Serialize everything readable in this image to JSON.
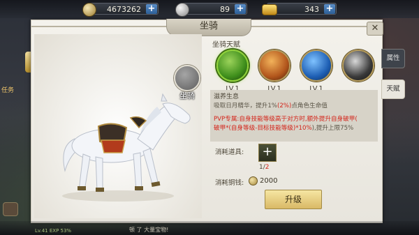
{
  "currencies": [
    {
      "icon": "copper-coin-icon",
      "value": "4673262"
    },
    {
      "icon": "silver-coin-icon",
      "value": "89"
    },
    {
      "icon": "gold-ingot-icon",
      "value": "343"
    }
  ],
  "panel": {
    "title": "坐骑",
    "close_icon": "close-icon",
    "mount_badge_label": "坐骑"
  },
  "talent_section": {
    "title": "坐骑天赋",
    "talents": [
      {
        "icon": "green-horse-talent-icon",
        "level": "LV.1",
        "color": "#3f8f1c",
        "selected": true
      },
      {
        "icon": "crossed-swords-talent-icon",
        "level": "LV.1",
        "color": "#b2561c",
        "selected": false
      },
      {
        "icon": "shield-talent-icon",
        "level": "LV.1",
        "color": "#1e5fb4",
        "selected": false
      },
      {
        "icon": "dragon-talent-icon",
        "level": "",
        "color": "#3a3a3a",
        "selected": false
      }
    ]
  },
  "description": {
    "name": "滋养生息",
    "line1_a": "吸取日月精华，提升1%",
    "line1_b": "(2%)",
    "line1_c": "点角色生命值",
    "line2": "PVP专属:自身技能等级高于对方时,额外提升自身破甲(",
    "line3_red": "破甲*(自身等级-目标技能等级)*10%",
    "line3_tail": "),提升上限75%"
  },
  "consume": {
    "item_label": "消耗道具:",
    "item_count_have": "1",
    "item_count_sep": "/",
    "item_count_need": "2",
    "copper_label": "消耗铜钱:",
    "copper_value": "2000"
  },
  "upgrade_button": "升级",
  "side_tabs": [
    {
      "label": "属性",
      "active": false
    },
    {
      "label": "天赋",
      "active": true
    }
  ],
  "hud": {
    "task_label": "任务",
    "bottom_chat": "顿 了 大量宝物!",
    "bottom_exp": "Lv.41 EXP 53%"
  },
  "colors": {
    "accent_green": "#8fd23a",
    "highlight_red": "#d4241a",
    "button_gold": "#d9b966"
  }
}
